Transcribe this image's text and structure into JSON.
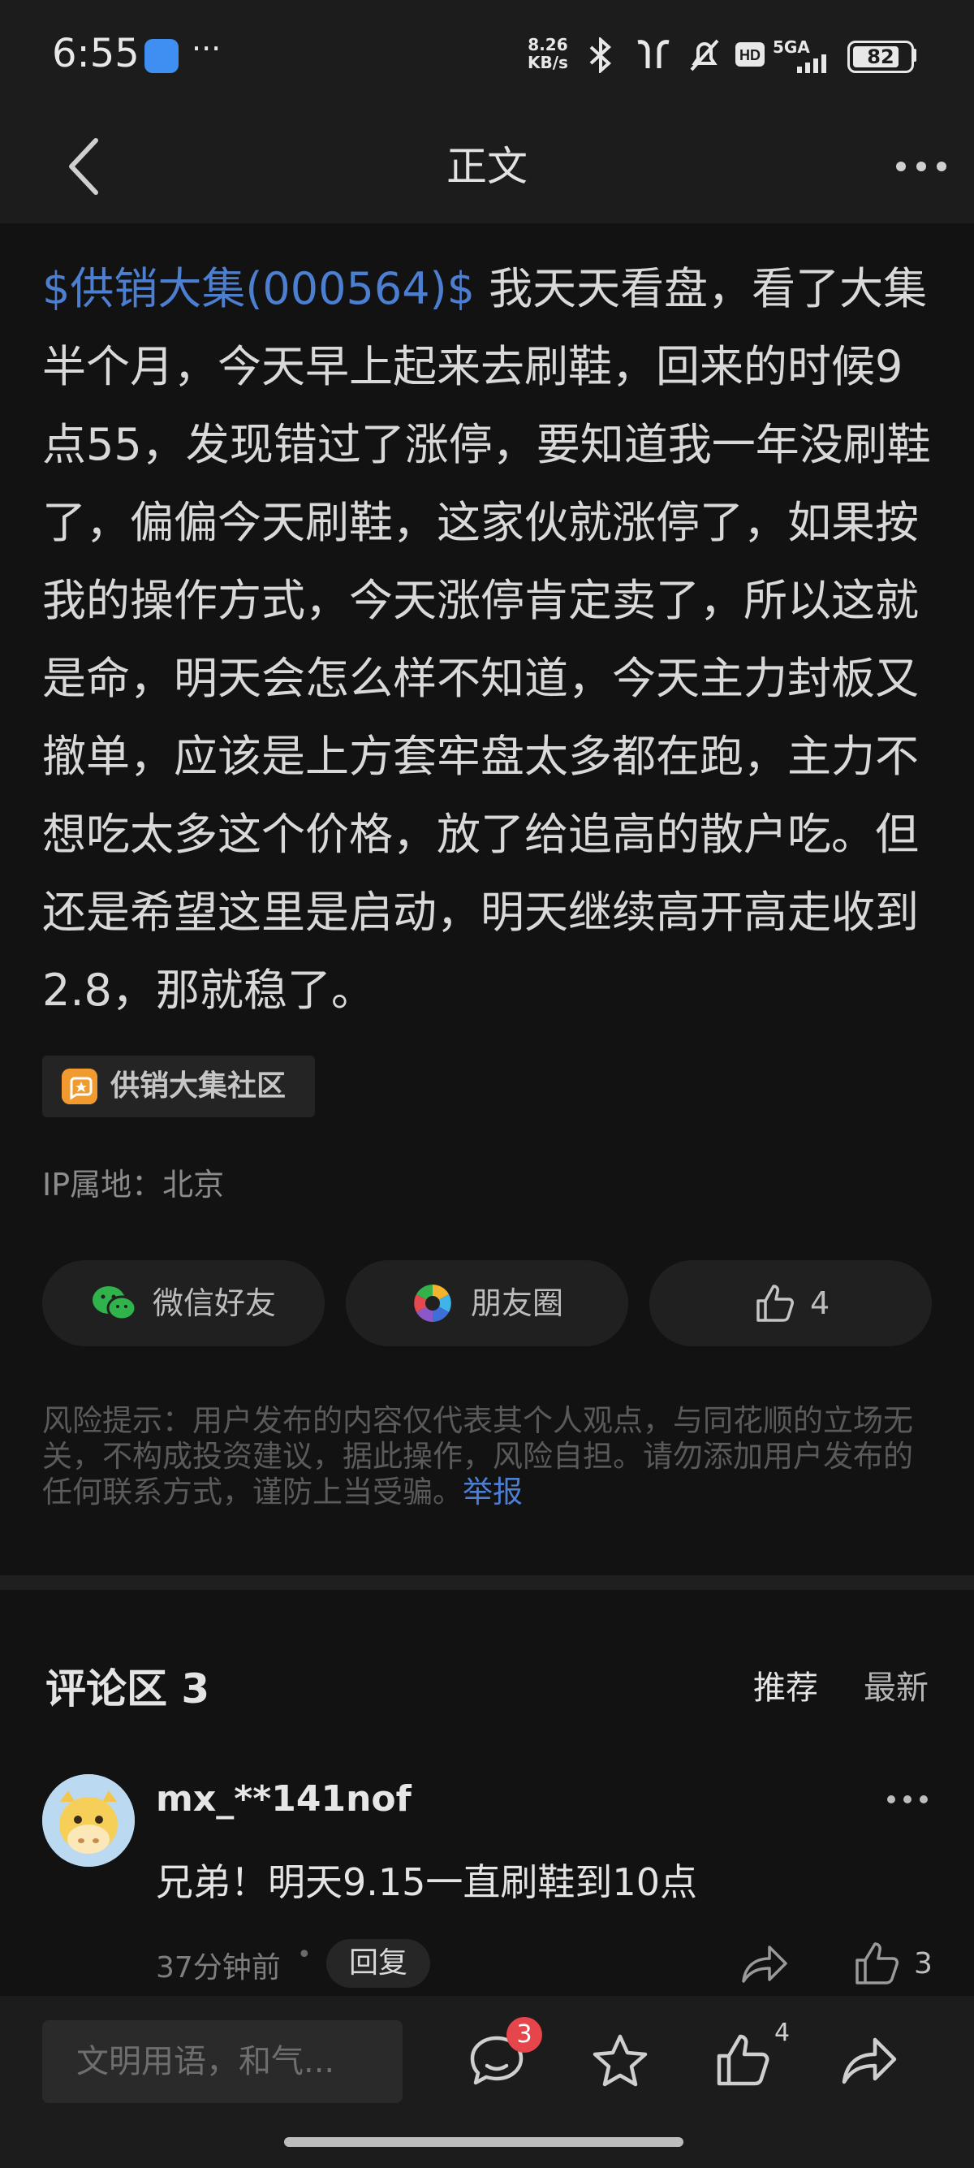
{
  "status": {
    "time": "6:55",
    "net_speed_value": "8.26",
    "net_speed_unit": "KB/s",
    "network": "5GA",
    "battery": "82"
  },
  "nav": {
    "title": "正文"
  },
  "post": {
    "stock_tag": "$供销大集(000564)$",
    "body": " 我天天看盘，看了大集半个月，今天早上起来去刷鞋，回来的时候9点55，发现错过了涨停，要知道我一年没刷鞋了，偏偏今天刷鞋，这家伙就涨停了，如果按我的操作方式，今天涨停肯定卖了，所以这就是命，明天会怎么样不知道，今天主力封板又撤单，应该是上方套牢盘太多都在跑，主力不想吃太多这个价格，放了给追高的散户吃。但还是希望这里是启动，明天继续高开高走收到2.8，那就稳了。",
    "community": "供销大集社区",
    "ip_location": "IP属地：北京"
  },
  "share": {
    "wechat": "微信好友",
    "moments": "朋友圈",
    "likes": "4"
  },
  "risk": {
    "text": "风险提示：用户发布的内容仅代表其个人观点，与同花顺的立场无关，不构成投资建议，据此操作，风险自担。请勿添加用户发布的任何联系方式，谨防上当受骗。",
    "report": "举报"
  },
  "comments": {
    "title": "评论区 3",
    "sort_recommend": "推荐",
    "sort_latest": "最新",
    "items": [
      {
        "user": "mx_**141nof",
        "text": "兄弟！明天9.15一直刷鞋到10点",
        "time": "37分钟前",
        "separator": "•",
        "reply": "回复",
        "likes": "3"
      }
    ]
  },
  "bottom": {
    "input_placeholder": "文明用语，和气...",
    "comment_badge": "3",
    "like_count": "4"
  }
}
